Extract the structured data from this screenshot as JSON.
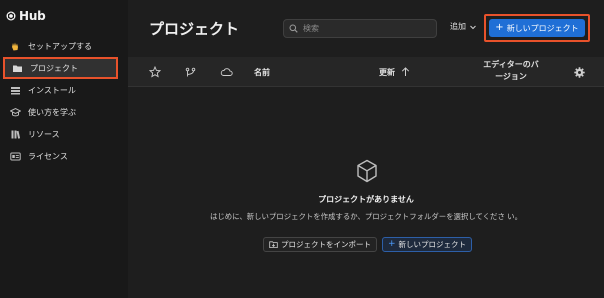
{
  "app": {
    "logo_text": "Hub"
  },
  "sidebar": {
    "items": [
      {
        "label": "セットアップする",
        "icon": "wave-hand-icon"
      },
      {
        "label": "プロジェクト",
        "icon": "folder-icon",
        "active": true
      },
      {
        "label": "インストール",
        "icon": "installs-icon"
      },
      {
        "label": "使い方を学ぶ",
        "icon": "graduation-cap-icon"
      },
      {
        "label": "リソース",
        "icon": "books-icon"
      },
      {
        "label": "ライセンス",
        "icon": "license-card-icon"
      }
    ]
  },
  "header": {
    "title": "プロジェクト",
    "search_placeholder": "検索",
    "add_label": "追加",
    "new_project_label": "新しいプロジェクト"
  },
  "table": {
    "col_name": "名前",
    "col_updated": "更新",
    "col_editor_line1": "エディターのバ",
    "col_editor_line2": "ージョン"
  },
  "empty_state": {
    "title": "プロジェクトがありません",
    "description": "はじめに、新しいプロジェクトを作成するか、プロジェクトフォルダーを選択してくださ い。",
    "import_label": "プロジェクトをインポート",
    "new_label": "新しいプロジェクト"
  },
  "colors": {
    "accent": "#1f6fd6",
    "highlight": "#e8522b",
    "sidebar_bg": "#191919",
    "main_bg": "#1e1e1e"
  }
}
